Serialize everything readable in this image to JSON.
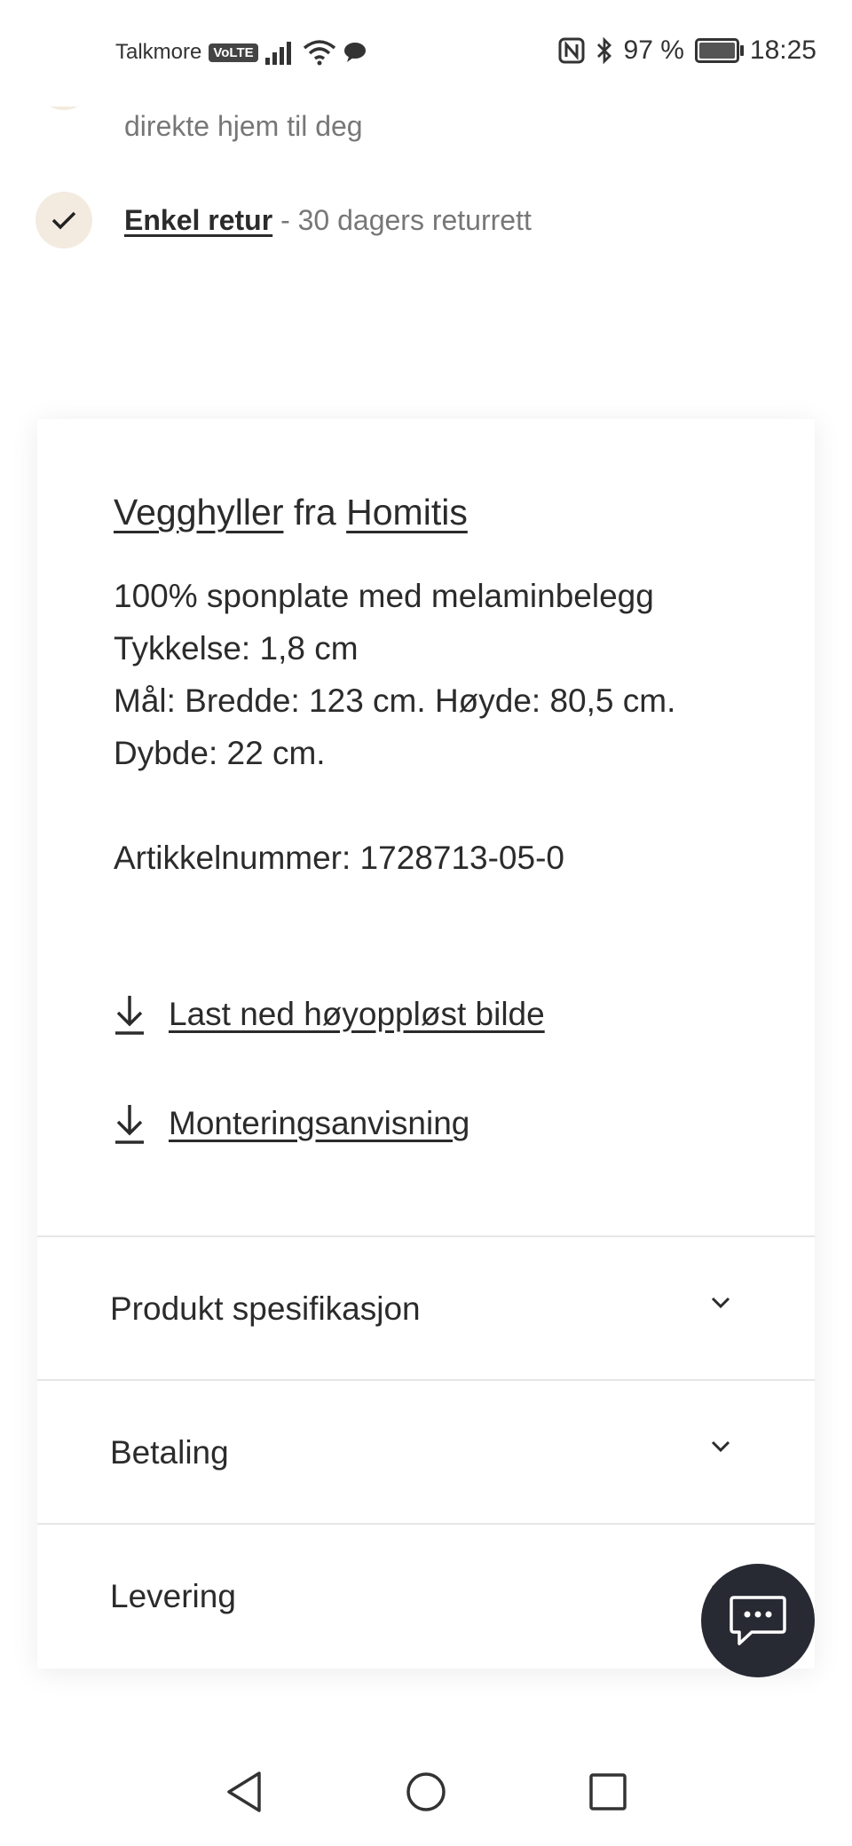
{
  "status_bar": {
    "carrier": "Talkmore",
    "volte": "VoLTE",
    "battery_percent": "97 %",
    "time": "18:25"
  },
  "features": [
    {
      "text": "direkte hjem til deg"
    },
    {
      "link": "Enkel retur",
      "text": " - 30 dagers returrett"
    }
  ],
  "product": {
    "category_link": "Vegghyller",
    "connector": "fra",
    "brand_link": "Homitis",
    "material": "100% sponplate med melaminbelegg",
    "thickness": "Tykkelse: 1,8 cm",
    "dimensions": "Mål: Bredde: 123 cm. Høyde: 80,5 cm.",
    "depth": "Dybde: 22 cm.",
    "article_number": "Artikkelnummer: 1728713-05-0"
  },
  "downloads": [
    {
      "label": "Last ned høyoppløst bilde",
      "icon": "download-icon"
    },
    {
      "label": "Monteringsanvisning",
      "icon": "download-icon"
    }
  ],
  "accordions": [
    {
      "label": "Produkt spesifikasjon"
    },
    {
      "label": "Betaling"
    },
    {
      "label": "Levering"
    }
  ]
}
